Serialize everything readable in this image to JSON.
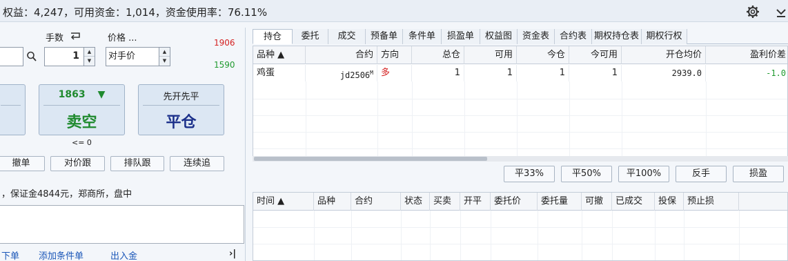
{
  "topbar": {
    "summary": "权益：4,247，可用资金：1,014，资金使用率：76.11%",
    "icons": [
      "gear-icon",
      "chevron-down-icon"
    ]
  },
  "order": {
    "qty_label": "手数",
    "price_label": "价格 ...",
    "qty_value": "1",
    "price_value": "对手价",
    "upper_limit": "1906",
    "lower_limit": "1590",
    "sell_price": "1863",
    "sell_arrow": "▼",
    "sell_label": "卖空",
    "close_mode": "先开先平",
    "close_label": "平仓",
    "sell_sub": "<= 0"
  },
  "order_actions": [
    "撤单",
    "对价跟",
    "排队跟",
    "连续追"
  ],
  "info_text": "，保证金4844元，郑商所，盘中",
  "bottom_links": [
    "下单",
    "添加条件单",
    "出入金"
  ],
  "collapse_glyph": "›|",
  "tabs": [
    "持仓",
    "委托",
    "成交",
    "预备单",
    "条件单",
    "损盈单",
    "权益图",
    "资金表",
    "合约表",
    "期权持仓表",
    "期权行权"
  ],
  "positions": {
    "headers": [
      "品种 ▲",
      "合约",
      "方向",
      "总仓",
      "可用",
      "今仓",
      "今可用",
      "开仓均价",
      "盈利价差"
    ],
    "rows": [
      {
        "product": "鸡蛋",
        "contract": "jd2506",
        "contract_sup": "M",
        "direction": "多",
        "total": "1",
        "available": "1",
        "today": "1",
        "today_available": "1",
        "avg_price": "2939.0",
        "pnl_spread": "-1.0"
      }
    ]
  },
  "position_actions": [
    "平33%",
    "平50%",
    "平100%",
    "反手",
    "损盈"
  ],
  "orders": {
    "headers": [
      "时间 ▲",
      "品种",
      "合约",
      "状态",
      "买卖",
      "开平",
      "委托价",
      "委托量",
      "可撤",
      "已成交",
      "投保",
      "预止损"
    ]
  },
  "colors": {
    "up_red": "#d42020",
    "down_green": "#1f9a2e",
    "sell_text": "#1f8a2e",
    "close_text": "#1a2f8a",
    "link_blue": "#1a56b8"
  }
}
